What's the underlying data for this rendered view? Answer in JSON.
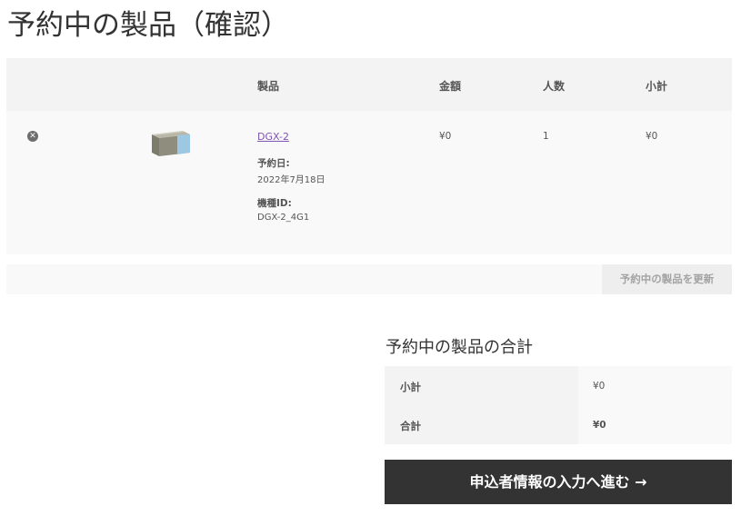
{
  "page": {
    "title": "予約中の製品（確認）"
  },
  "cart": {
    "headers": {
      "product": "製品",
      "price": "金額",
      "quantity": "人数",
      "subtotal": "小計"
    },
    "items": [
      {
        "name": "DGX-2",
        "meta": [
          {
            "label": "予約日:",
            "value": "2022年7月18日"
          },
          {
            "label": "機種ID:",
            "value": "DGX-2_4G1"
          }
        ],
        "price": "¥0",
        "quantity": "1",
        "subtotal": "¥0"
      }
    ],
    "update_button": "予約中の製品を更新"
  },
  "totals": {
    "title": "予約中の製品の合計",
    "rows": [
      {
        "label": "小計",
        "value": "¥0"
      },
      {
        "label": "合計",
        "value": "¥0"
      }
    ]
  },
  "checkout": {
    "label": "申込者情報の入力へ進む →"
  },
  "icons": {
    "remove": "remove-circle-x-icon",
    "thumbnail": "server-box-image"
  },
  "colors": {
    "link": "#7f54b3",
    "checkout_bg": "#333333",
    "header_bg": "#f3f3f3"
  }
}
